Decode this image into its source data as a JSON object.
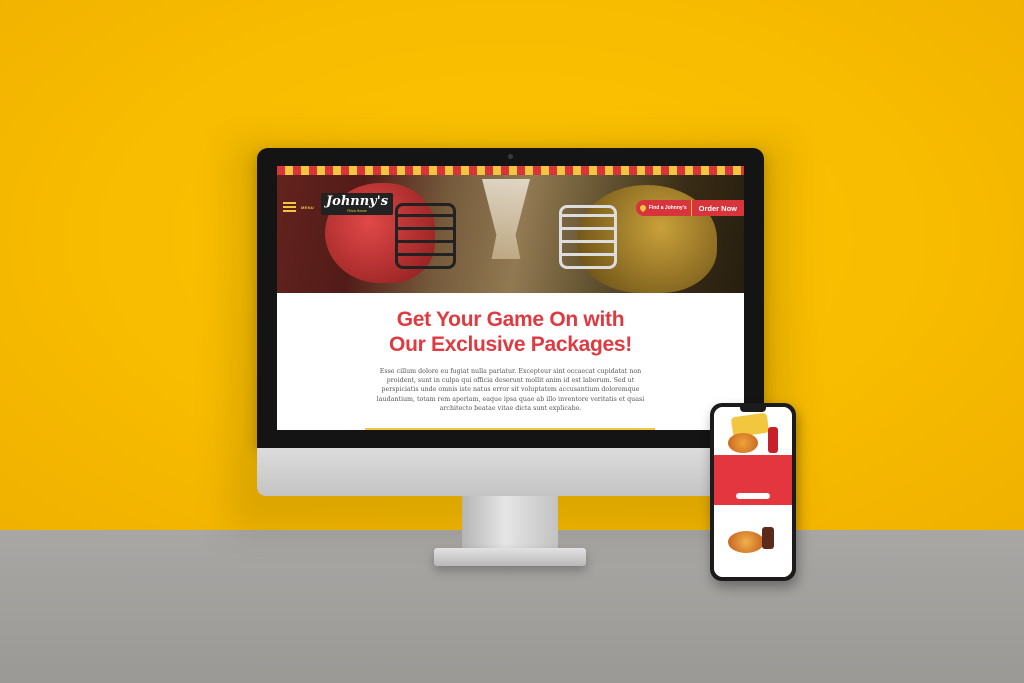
{
  "desktop": {
    "nav": {
      "menu_label": "MENU"
    },
    "logo": {
      "name": "Johnny's",
      "tagline": "Pizza House"
    },
    "cta": {
      "find_label": "Find a Johnny's",
      "order_label": "Order Now"
    },
    "headline_line1": "Get Your Game On with",
    "headline_line2": "Our Exclusive Packages!",
    "body": "Esse cillum dolore eu fugiat nulla pariatur. Excepteur sint occaecat cupidatat non proident, sunt in culpa qui officia deserunt mollit anim id est laborum. Sed ut perspiciatis unde omnis iste natus error sit voluptatem accusantium doloremque laudantium, totam rem aperiam, eaque ipsa quae ab illo inventore veritatis et quasi architecto beatae vitae dicta sunt explicabo."
  },
  "colors": {
    "brand_red": "#d7343c",
    "brand_yellow": "#f2c63f",
    "background": "#f6bd00"
  }
}
